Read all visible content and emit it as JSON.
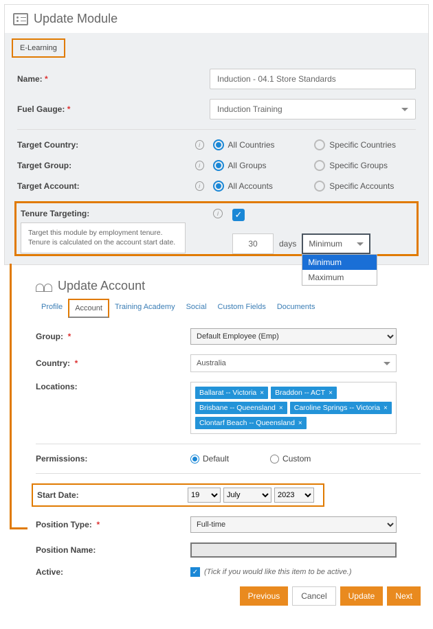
{
  "module": {
    "title": "Update Module",
    "tab_label": "E-Learning",
    "fields": {
      "name_label": "Name:",
      "name_value": "Induction - 04.1 Store Standards",
      "fuel_label": "Fuel Gauge:",
      "fuel_value": "Induction Training"
    },
    "target_country": {
      "label": "Target Country:",
      "opt_all": "All Countries",
      "opt_specific": "Specific Countries"
    },
    "target_group": {
      "label": "Target Group:",
      "opt_all": "All Groups",
      "opt_specific": "Specific Groups"
    },
    "target_account": {
      "label": "Target Account:",
      "opt_all": "All Accounts",
      "opt_specific": "Specific Accounts"
    },
    "tenure": {
      "label": "Tenure Targeting:",
      "tooltip": "Target this module by employment tenure. Tenure is calculated on the account start date.",
      "days_value": "30",
      "days_label": "days",
      "dd_selected": "Minimum",
      "dd_opt1": "Minimum",
      "dd_opt2": "Maximum"
    }
  },
  "account": {
    "title": "Update Account",
    "tabs": {
      "profile": "Profile",
      "account": "Account",
      "training": "Training Academy",
      "social": "Social",
      "custom": "Custom Fields",
      "docs": "Documents"
    },
    "group": {
      "label": "Group:",
      "value": "Default Employee (Emp)"
    },
    "country": {
      "label": "Country:",
      "value": "Australia"
    },
    "locations": {
      "label": "Locations:",
      "tags": [
        "Ballarat -- Victoria",
        "Braddon -- ACT",
        "Brisbane -- Queensland",
        "Caroline Springs -- Victoria",
        "Clontarf Beach -- Queensland"
      ]
    },
    "permissions": {
      "label": "Permissions:",
      "default": "Default",
      "custom": "Custom"
    },
    "start_date": {
      "label": "Start Date:",
      "day": "19",
      "month": "July",
      "year": "2023"
    },
    "position_type": {
      "label": "Position Type:",
      "value": "Full-time"
    },
    "position_name": {
      "label": "Position Name:"
    },
    "active": {
      "label": "Active:",
      "note": "(Tick if you would like this item to be active.)"
    },
    "buttons": {
      "prev": "Previous",
      "cancel": "Cancel",
      "update": "Update",
      "next": "Next"
    }
  }
}
